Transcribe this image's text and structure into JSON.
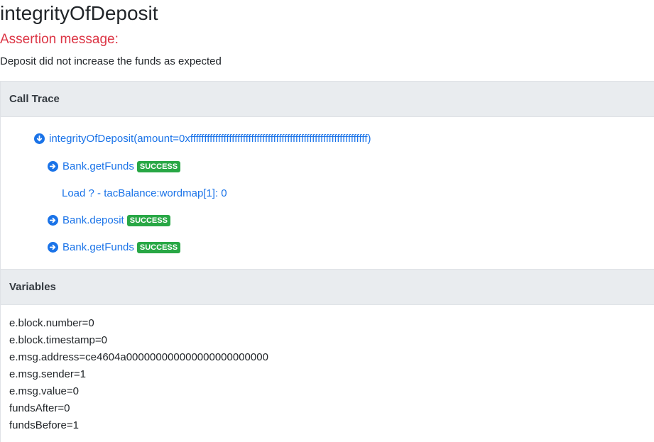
{
  "title": "integrityOfDeposit",
  "assertion": {
    "label": "Assertion message:",
    "message": "Deposit did not increase the funds as expected"
  },
  "call_trace": {
    "header": "Call Trace",
    "root": "integrityOfDeposit(amount=0xffffffffffffffffffffffffffffffffffffffffffffffffffffffffffffffff)",
    "calls": [
      {
        "label": "Bank.getFunds",
        "status": "SUCCESS"
      },
      {
        "label": "Bank.deposit",
        "status": "SUCCESS"
      },
      {
        "label": "Bank.getFunds",
        "status": "SUCCESS"
      }
    ],
    "load_line": "Load ? - tacBalance:wordmap[1]: 0"
  },
  "variables": {
    "header": "Variables",
    "items": [
      "e.block.number=0",
      "e.block.timestamp=0",
      "e.msg.address=ce4604a000000000000000000000000",
      "e.msg.sender=1",
      "e.msg.value=0",
      "fundsAfter=0",
      "fundsBefore=1"
    ]
  },
  "colors": {
    "link": "#1a73e8",
    "success": "#28a745",
    "assertion": "#dc3545",
    "header_bg": "#e9ecef"
  }
}
